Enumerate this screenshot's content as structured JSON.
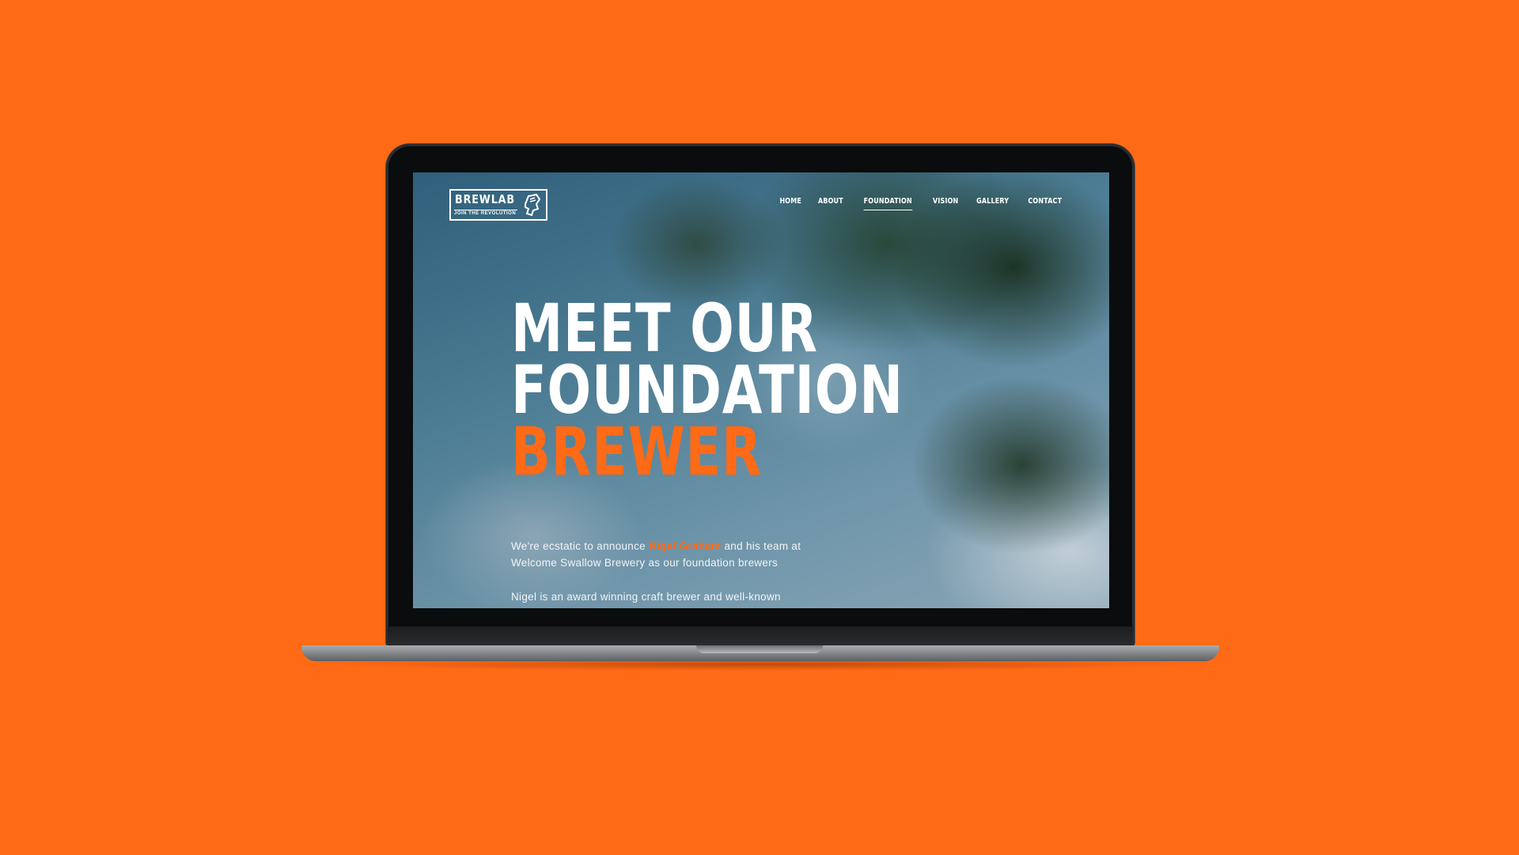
{
  "site": {
    "logo": {
      "wordmark": "BREWLAB",
      "tagline": "JOIN THE REVOLUTION"
    },
    "nav": [
      {
        "label": "HOME",
        "active": false
      },
      {
        "label": "ABOUT",
        "active": false
      },
      {
        "label": "FOUNDATION",
        "active": true
      },
      {
        "label": "VISION",
        "active": false
      },
      {
        "label": "GALLERY",
        "active": false
      },
      {
        "label": "CONTACT",
        "active": false
      }
    ],
    "hero": {
      "line1": "MEET OUR",
      "line2": "FOUNDATION",
      "line3": "BREWER"
    },
    "intro": {
      "before": "We're ecstatic to announce ",
      "name": "Nigel Graham",
      "after": " and his team at Welcome Swallow Brewery as our foundation brewers"
    },
    "paragraph2": "Nigel is an award winning craft brewer and well-known"
  },
  "colors": {
    "background": "#FF6A16",
    "accent": "#FF6A16",
    "text": "#FFFFFF"
  }
}
